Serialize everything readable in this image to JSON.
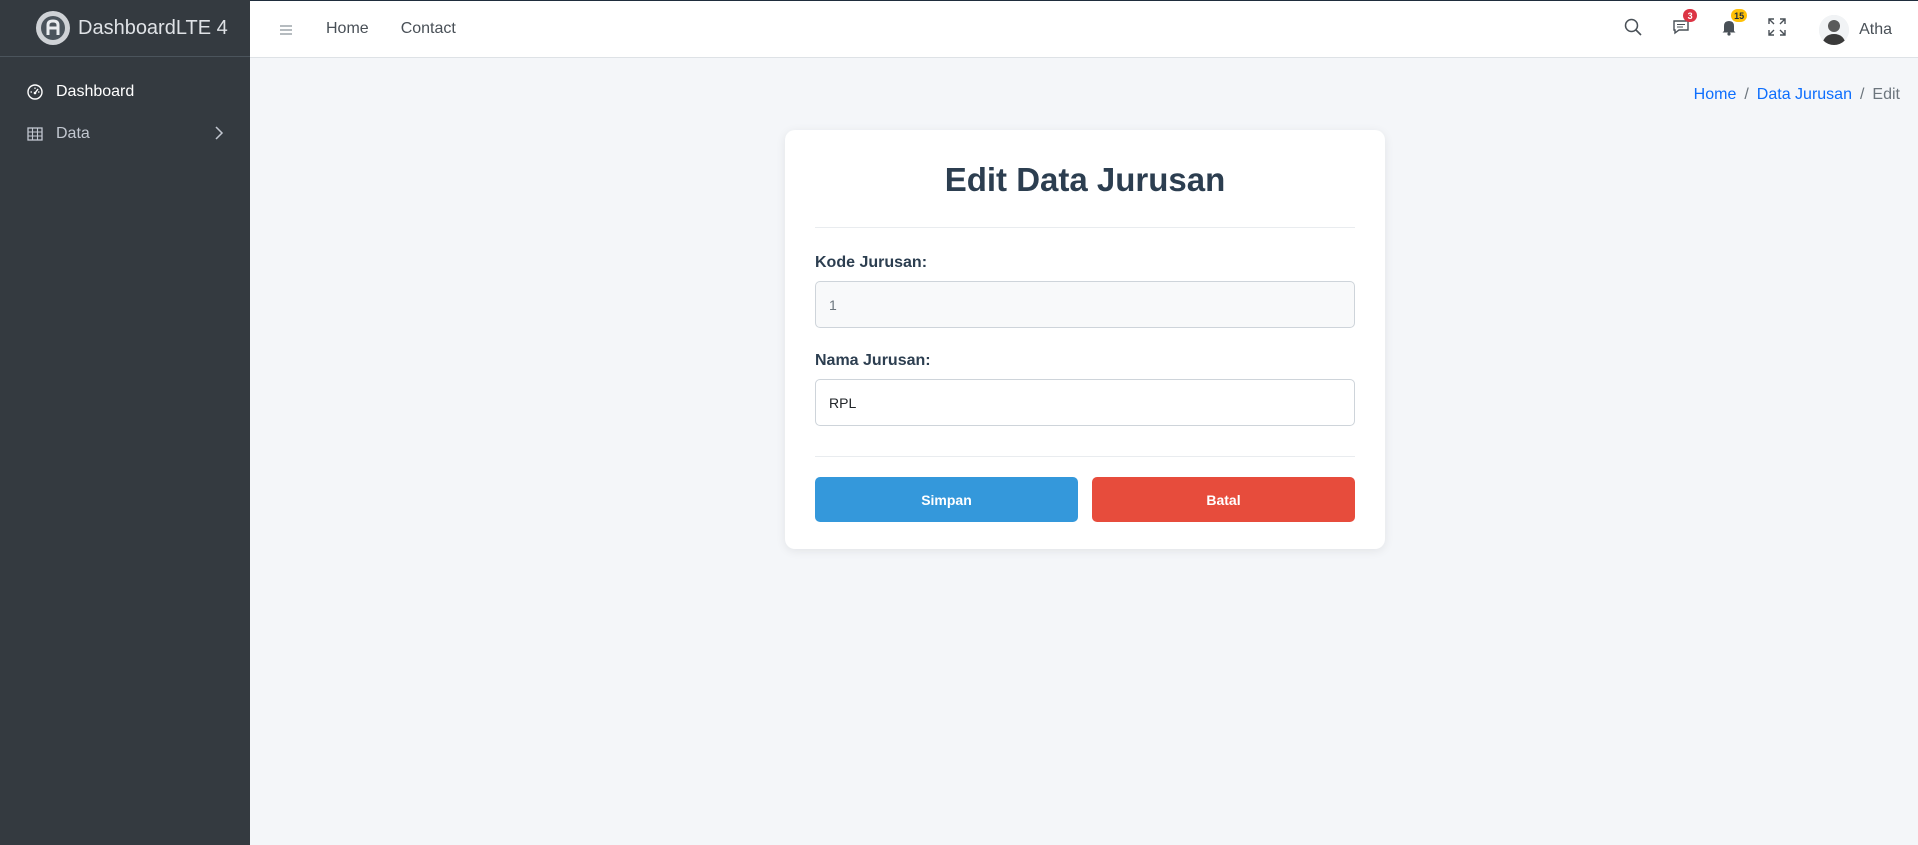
{
  "brand": {
    "name": "DashboardLTE 4",
    "logo_icon": "adminlte-logo-icon"
  },
  "sidebar": {
    "items": [
      {
        "label": "Dashboard",
        "icon": "speedometer-icon",
        "active": true
      },
      {
        "label": "Data",
        "icon": "table-icon",
        "has_submenu": true
      }
    ]
  },
  "topnav": {
    "menu_icon": "hamburger-icon",
    "links": [
      "Home",
      "Contact"
    ],
    "messages_badge": "3",
    "notifications_badge": "15",
    "user_name": "Atha"
  },
  "breadcrumb": {
    "items": [
      "Home",
      "Data Jurusan"
    ],
    "separator": "/",
    "current": "Edit"
  },
  "form": {
    "title": "Edit Data Jurusan",
    "kode_label": "Kode Jurusan:",
    "kode_value": "1",
    "nama_label": "Nama Jurusan:",
    "nama_value": "RPL",
    "save_label": "Simpan",
    "cancel_label": "Batal"
  },
  "colors": {
    "sidebar_bg": "#343a40",
    "content_bg": "#f4f6f9",
    "save_button": "#3498db",
    "cancel_button": "#e74c3c",
    "link": "#0d6efd",
    "badge_messages": "#dc3545",
    "badge_notifications": "#ffc107"
  }
}
